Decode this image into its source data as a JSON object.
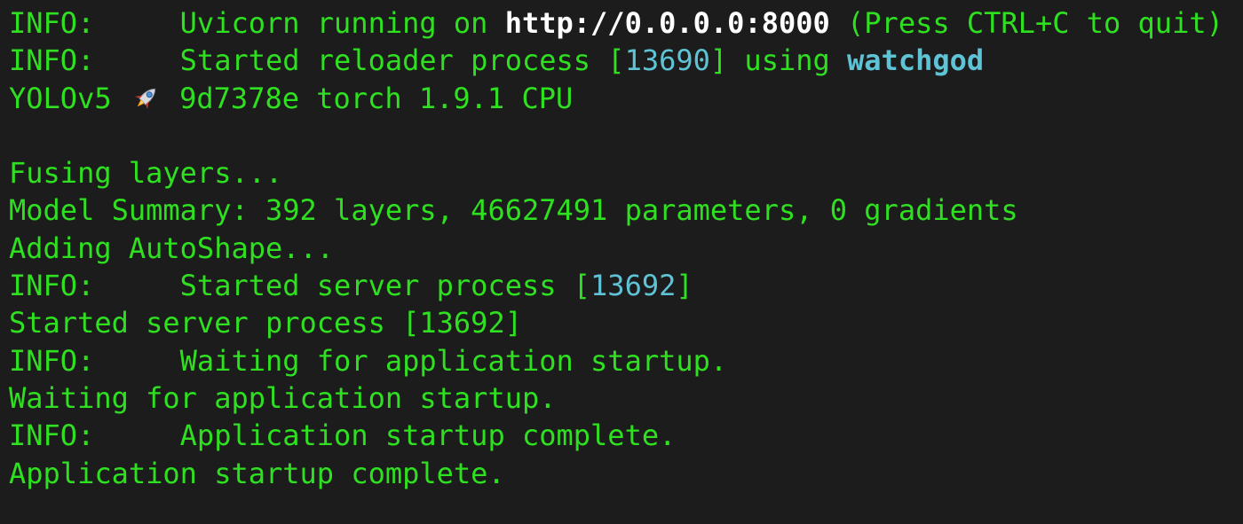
{
  "window": {
    "type": "terminal"
  },
  "colors": {
    "background": "#1c1c1c",
    "text_green": "#2fe021",
    "text_white": "#ffffff",
    "text_cyan": "#5fc3d6"
  },
  "lines": [
    {
      "segments": [
        {
          "text": "INFO:     Uvicorn running on ",
          "style": "green"
        },
        {
          "text": "http://0.0.0.0:8000",
          "style": "white"
        },
        {
          "text": " (Press CTRL+C to quit)",
          "style": "green"
        }
      ]
    },
    {
      "segments": [
        {
          "text": "INFO:     Started reloader process [",
          "style": "green"
        },
        {
          "text": "13690",
          "style": "cyan"
        },
        {
          "text": "] using ",
          "style": "green"
        },
        {
          "text": "watchgod",
          "style": "cyan-bold"
        }
      ]
    },
    {
      "segments": [
        {
          "text": "YOLOv5 ",
          "style": "green"
        },
        {
          "icon": "rocket-icon"
        },
        {
          "text": " 9d7378e torch 1.9.1 CPU",
          "style": "green"
        }
      ]
    },
    {
      "segments": [
        {
          "text": "",
          "style": "green"
        }
      ]
    },
    {
      "segments": [
        {
          "text": "Fusing layers...",
          "style": "green"
        }
      ]
    },
    {
      "segments": [
        {
          "text": "Model Summary: 392 layers, 46627491 parameters, 0 gradients",
          "style": "green"
        }
      ]
    },
    {
      "segments": [
        {
          "text": "Adding AutoShape...",
          "style": "green"
        }
      ]
    },
    {
      "segments": [
        {
          "text": "INFO:     Started server process [",
          "style": "green"
        },
        {
          "text": "13692",
          "style": "cyan"
        },
        {
          "text": "]",
          "style": "green"
        }
      ]
    },
    {
      "segments": [
        {
          "text": "Started server process [13692]",
          "style": "green"
        }
      ]
    },
    {
      "segments": [
        {
          "text": "INFO:     Waiting for application startup.",
          "style": "green"
        }
      ]
    },
    {
      "segments": [
        {
          "text": "Waiting for application startup.",
          "style": "green"
        }
      ]
    },
    {
      "segments": [
        {
          "text": "INFO:     Application startup complete.",
          "style": "green"
        }
      ]
    },
    {
      "segments": [
        {
          "text": "Application startup complete.",
          "style": "green"
        }
      ]
    }
  ]
}
